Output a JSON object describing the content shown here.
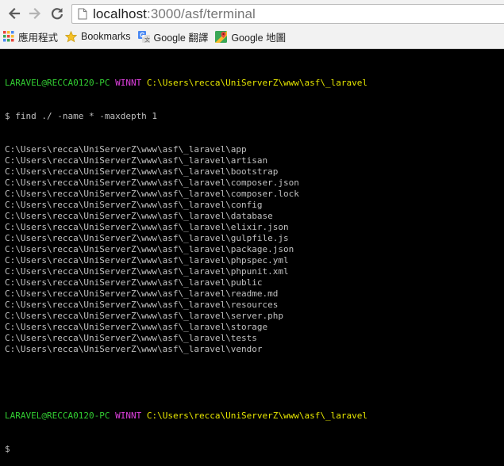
{
  "browser": {
    "url_host": "localhost",
    "url_path": ":3000/asf/terminal",
    "icons": {
      "back": "back-arrow-icon",
      "forward": "forward-arrow-icon",
      "reload": "reload-icon",
      "page": "page-icon"
    },
    "bookmarks": [
      {
        "label": "應用程式",
        "icon": "apps-grid-icon"
      },
      {
        "label": "Bookmarks",
        "icon": "star-icon"
      },
      {
        "label": "Google 翻譯",
        "icon": "google-translate-icon"
      },
      {
        "label": "Google 地圖",
        "icon": "google-maps-icon"
      }
    ]
  },
  "terminal": {
    "colors": {
      "user": "#32cd32",
      "system": "#e040e0",
      "path": "#e6e600",
      "text": "#c0c0c0"
    },
    "prompt1": {
      "user": "LARAVEL@RECCA0120-PC",
      "system": "WINNT",
      "path": "C:\\Users\\recca\\UniServerZ\\www\\asf\\_laravel"
    },
    "command": "$ find ./ -name * -maxdepth 1",
    "output": [
      "C:\\Users\\recca\\UniServerZ\\www\\asf\\_laravel\\app",
      "C:\\Users\\recca\\UniServerZ\\www\\asf\\_laravel\\artisan",
      "C:\\Users\\recca\\UniServerZ\\www\\asf\\_laravel\\bootstrap",
      "C:\\Users\\recca\\UniServerZ\\www\\asf\\_laravel\\composer.json",
      "C:\\Users\\recca\\UniServerZ\\www\\asf\\_laravel\\composer.lock",
      "C:\\Users\\recca\\UniServerZ\\www\\asf\\_laravel\\config",
      "C:\\Users\\recca\\UniServerZ\\www\\asf\\_laravel\\database",
      "C:\\Users\\recca\\UniServerZ\\www\\asf\\_laravel\\elixir.json",
      "C:\\Users\\recca\\UniServerZ\\www\\asf\\_laravel\\gulpfile.js",
      "C:\\Users\\recca\\UniServerZ\\www\\asf\\_laravel\\package.json",
      "C:\\Users\\recca\\UniServerZ\\www\\asf\\_laravel\\phpspec.yml",
      "C:\\Users\\recca\\UniServerZ\\www\\asf\\_laravel\\phpunit.xml",
      "C:\\Users\\recca\\UniServerZ\\www\\asf\\_laravel\\public",
      "C:\\Users\\recca\\UniServerZ\\www\\asf\\_laravel\\readme.md",
      "C:\\Users\\recca\\UniServerZ\\www\\asf\\_laravel\\resources",
      "C:\\Users\\recca\\UniServerZ\\www\\asf\\_laravel\\server.php",
      "C:\\Users\\recca\\UniServerZ\\www\\asf\\_laravel\\storage",
      "C:\\Users\\recca\\UniServerZ\\www\\asf\\_laravel\\tests",
      "C:\\Users\\recca\\UniServerZ\\www\\asf\\_laravel\\vendor"
    ],
    "prompt2": {
      "user": "LARAVEL@RECCA0120-PC",
      "system": "WINNT",
      "path": "C:\\Users\\recca\\UniServerZ\\www\\asf\\_laravel"
    },
    "input_prompt": "$"
  }
}
